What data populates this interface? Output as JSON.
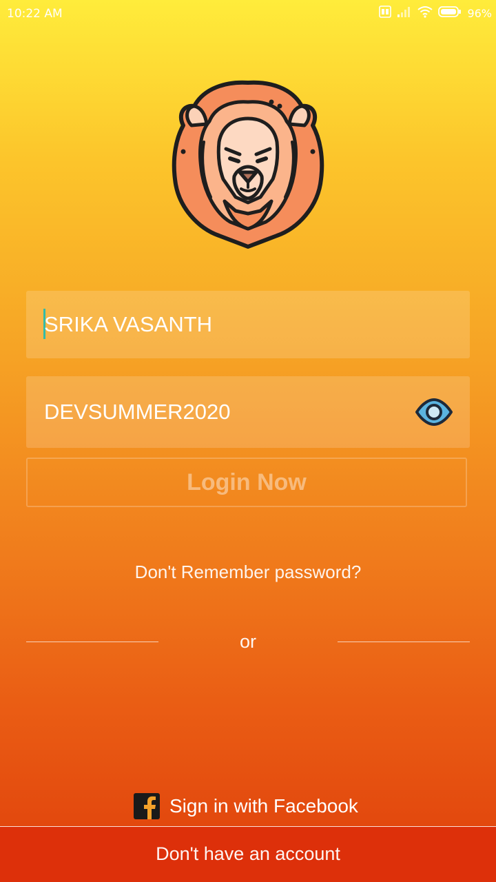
{
  "status_bar": {
    "time": "10:22 AM",
    "battery_percent": "96%",
    "icons": [
      "volte-icon",
      "signal-icon",
      "wifi-icon",
      "battery-icon"
    ]
  },
  "logo": {
    "icon": "lion-head-icon"
  },
  "form": {
    "username_value": "SRIKA VASANTH",
    "password_value": "DEVSUMMER2020",
    "password_toggle_icon": "eye-icon",
    "login_label": "Login Now"
  },
  "links": {
    "forgot_password": "Don't Remember password?",
    "divider_text": "or",
    "facebook_signin": "Sign in with Facebook",
    "signup": "Don't have an account"
  },
  "colors": {
    "gradient_top": "#ffec3b",
    "gradient_bottom": "#df3f0b",
    "bottom_bar": "#dd300a",
    "cursor": "#33bba8",
    "eye_iris": "#5bb4e0"
  }
}
